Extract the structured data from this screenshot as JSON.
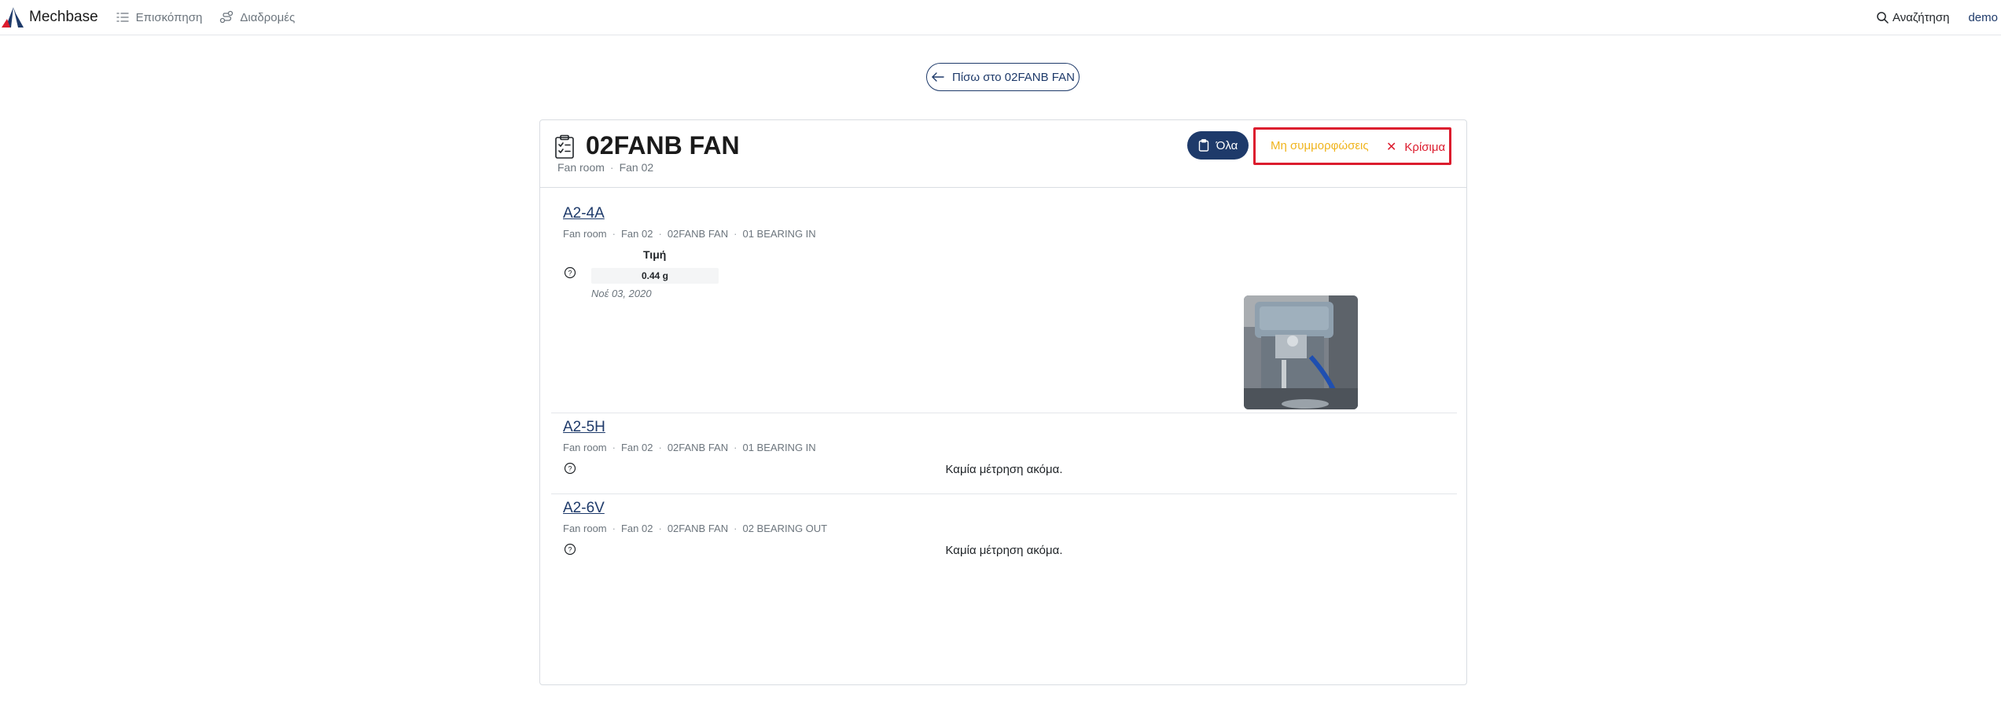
{
  "nav": {
    "brand": "Mechbase",
    "links": [
      {
        "label": "Επισκόπηση",
        "icon": "list-icon"
      },
      {
        "label": "Διαδρομές",
        "icon": "route-icon"
      }
    ],
    "search_label": "Αναζήτηση",
    "user": "demo"
  },
  "back_button": {
    "label": "Πίσω στο 02FANB FAN"
  },
  "asset": {
    "title": "02FANB FAN",
    "breadcrumb": [
      "Fan room",
      "Fan 02"
    ]
  },
  "filters": {
    "all": "Όλα",
    "noncompliances": "Μη συμμορφώσεις",
    "critical": "Κρίσιμα",
    "critical_icon": "x-icon"
  },
  "colors": {
    "primary": "#1e3a6a",
    "warning": "#f0b41c",
    "danger": "#dc1c2e"
  },
  "points": [
    {
      "name": "A2-4A",
      "breadcrumb": [
        "Fan room",
        "Fan 02",
        "02FANB FAN",
        "01 BEARING IN"
      ],
      "value_header": "Τιμή",
      "value": "0.44 g",
      "date": "Νοέ 03, 2020"
    },
    {
      "name": "A2-5H",
      "breadcrumb": [
        "Fan room",
        "Fan 02",
        "02FANB FAN",
        "01 BEARING IN"
      ],
      "empty_text": "Καμία μέτρηση ακόμα."
    },
    {
      "name": "A2-6V",
      "breadcrumb": [
        "Fan room",
        "Fan 02",
        "02FANB FAN",
        "02 BEARING OUT"
      ],
      "empty_text": "Καμία μέτρηση ακόμα."
    }
  ]
}
